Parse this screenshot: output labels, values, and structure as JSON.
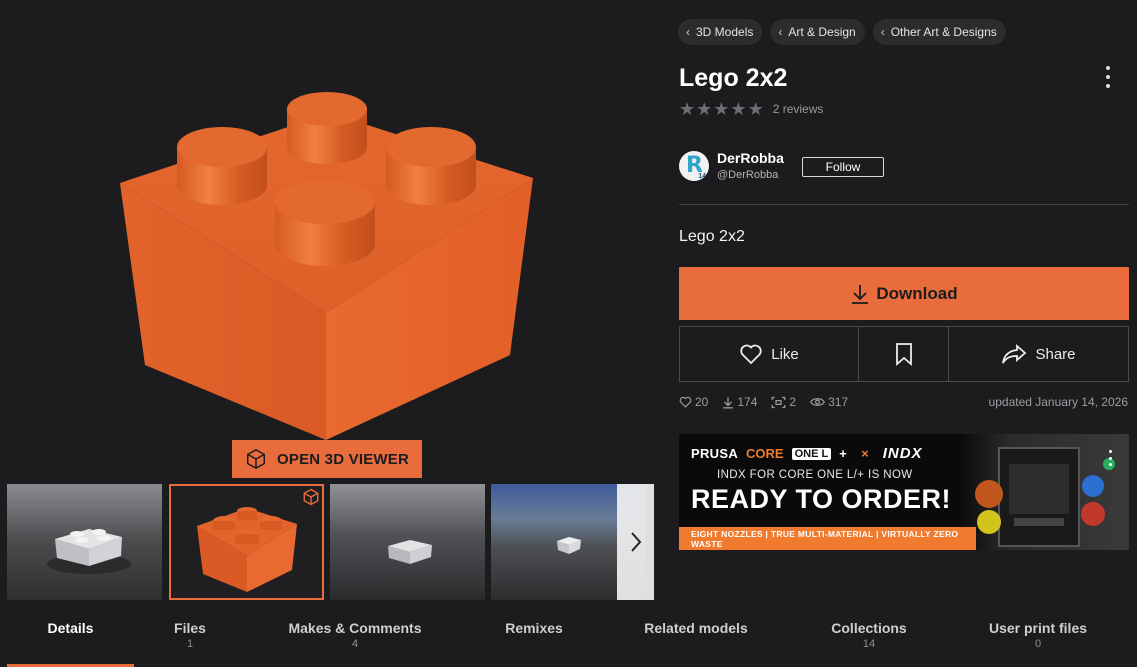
{
  "viewer": {
    "open_3d_label": "OPEN 3D VIEWER"
  },
  "breadcrumbs": [
    {
      "label": "3D Models"
    },
    {
      "label": "Art & Design"
    },
    {
      "label": "Other Art & Designs"
    }
  ],
  "model": {
    "title": "Lego 2x2",
    "reviews_label": "2 reviews",
    "stars": 0,
    "description": "Lego 2x2"
  },
  "author": {
    "name": "DerRobba",
    "handle": "@DerRobba",
    "avatar_letter": "R",
    "avatar_level": "14",
    "follow_label": "Follow"
  },
  "actions": {
    "download_label": "Download",
    "like_label": "Like",
    "share_label": "Share"
  },
  "stats": {
    "likes": "20",
    "downloads": "174",
    "makes": "2",
    "views": "317",
    "updated": "updated January 14, 2026"
  },
  "ad": {
    "brand": "PRUSA",
    "product": "CORE",
    "product_badge": "ONE L",
    "plus": "+",
    "cross": "×",
    "partner": "INDX",
    "line1": "INDX FOR CORE ONE L/+ IS NOW",
    "line2": "READY TO ORDER!",
    "bar": "EIGHT NOZZLES | TRUE MULTI-MATERIAL | VIRTUALLY ZERO WASTE"
  },
  "tabs": [
    {
      "label": "Details",
      "count": ""
    },
    {
      "label": "Files",
      "count": "1"
    },
    {
      "label": "Makes & Comments",
      "count": "4"
    },
    {
      "label": "Remixes",
      "count": ""
    },
    {
      "label": "Related models",
      "count": ""
    },
    {
      "label": "Collections",
      "count": "14"
    },
    {
      "label": "User print files",
      "count": "0"
    }
  ],
  "colors": {
    "accent": "#e96c3c",
    "background": "#1c1c1e",
    "brick": "#e8632c"
  }
}
